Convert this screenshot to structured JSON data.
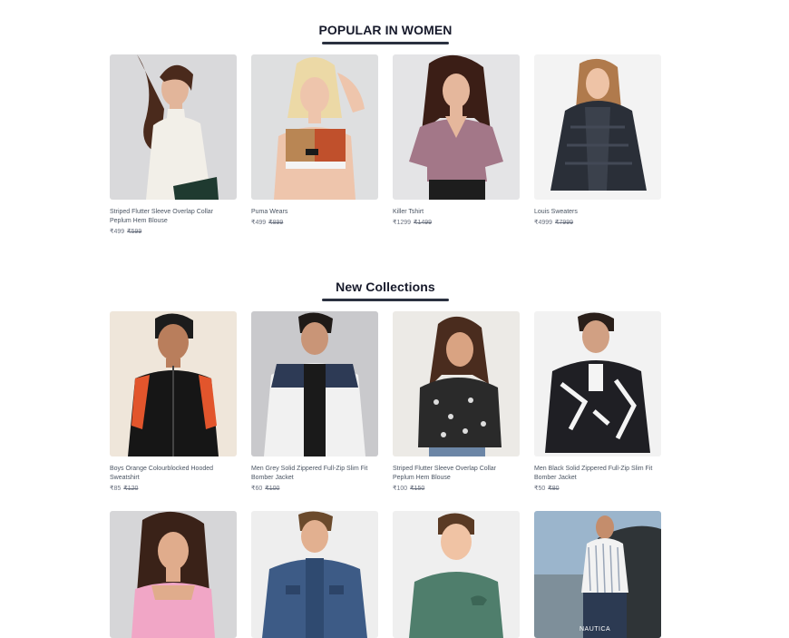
{
  "sections": [
    {
      "title": "POPULAR IN WOMEN",
      "products": [
        {
          "name": "Striped Flutter Sleeve Overlap Collar Peplum Hem Blouse",
          "price": "₹499",
          "old_price": "₹599",
          "image_icon": "woman-white-turtleneck-photo"
        },
        {
          "name": "Puma Wears",
          "price": "₹499",
          "old_price": "₹899",
          "image_icon": "woman-sports-top-photo"
        },
        {
          "name": "Killer Tshirt",
          "price": "₹1299",
          "old_price": "₹1499",
          "image_icon": "woman-mauve-blouse-photo"
        },
        {
          "name": "Louis Sweaters",
          "price": "₹4999",
          "old_price": "₹7999",
          "image_icon": "woman-fur-jacket-photo"
        }
      ]
    },
    {
      "title": "New Collections",
      "products": [
        {
          "name": "Boys Orange Colourblocked Hooded Sweatshirt",
          "price": "₹85",
          "old_price": "₹120",
          "image_icon": "boy-black-track-jacket-photo"
        },
        {
          "name": "Men Grey Solid Zippered Full-Zip Slim Fit Bomber Jacket",
          "price": "₹60",
          "old_price": "₹100",
          "image_icon": "man-puffer-jacket-photo"
        },
        {
          "name": "Striped Flutter Sleeve Overlap Collar Peplum Hem Blouse",
          "price": "₹100",
          "old_price": "₹150",
          "image_icon": "woman-floral-top-photo"
        },
        {
          "name": "Men Black Solid Zippered Full-Zip Slim Fit Bomber Jacket",
          "price": "₹50",
          "old_price": "₹80",
          "image_icon": "man-printed-bomber-photo"
        }
      ]
    }
  ],
  "more_products": [
    {
      "image_icon": "woman-pink-top-photo"
    },
    {
      "image_icon": "man-denim-jacket-photo"
    },
    {
      "image_icon": "boy-green-sweatshirt-photo"
    },
    {
      "image_icon": "man-striped-shirt-car-photo",
      "brand_text": "NAUTICA"
    }
  ]
}
